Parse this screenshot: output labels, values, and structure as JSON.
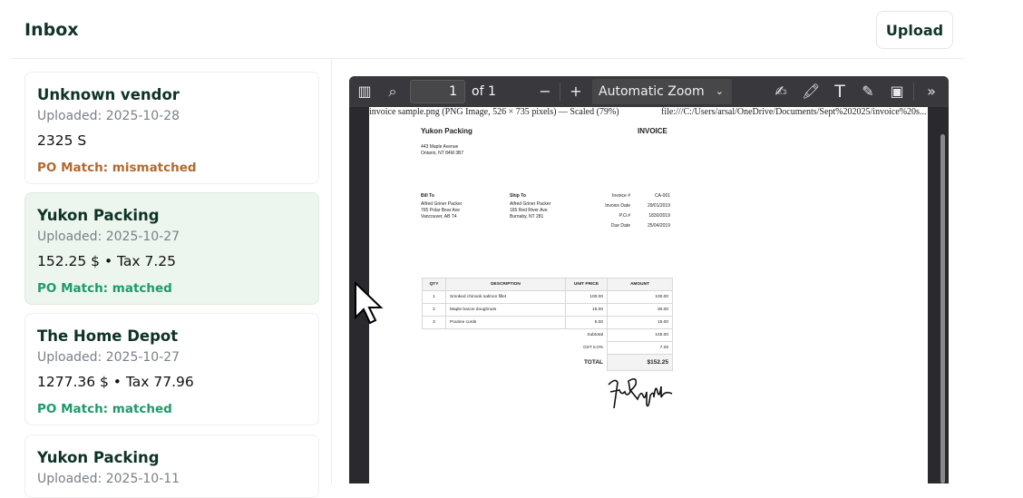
{
  "header": {
    "title": "Inbox",
    "upload_label": "Upload"
  },
  "invoices": [
    {
      "vendor": "Unknown vendor",
      "uploaded": "Uploaded: 2025-10-28",
      "amount": "2325 S",
      "po_match": "PO Match: mismatched"
    },
    {
      "vendor": "Yukon Packing",
      "uploaded": "Uploaded: 2025-10-27",
      "amount": "152.25 $ • Tax 7.25",
      "po_match": "PO Match: matched"
    },
    {
      "vendor": "The Home Depot",
      "uploaded": "Uploaded: 2025-10-27",
      "amount": "1277.36 $ • Tax 77.96",
      "po_match": "PO Match: matched"
    },
    {
      "vendor": "Yukon Packing",
      "uploaded": "Uploaded: 2025-10-11"
    }
  ],
  "viewer": {
    "page_number": "1",
    "page_count": "of 1",
    "zoom": "Automatic Zoom",
    "file_title": "invoice sample.png (PNG Image, 526 × 735 pixels) — Scaled (79%)",
    "file_url": "file:///C:/Users/arsal/OneDrive/Documents/Sept%202025/invoice%20s..."
  },
  "document": {
    "company": "Yukon Packing",
    "doc_title": "INVOICE",
    "address": [
      "443 Maple Avenue",
      "Ontario, NT 84M 3B7"
    ],
    "bill_to": {
      "label": "Bill To",
      "lines": [
        "Alfred Griner Packer",
        "765 Polar Bear Ave",
        "Vancouver, AB T4"
      ]
    },
    "ship_to": {
      "label": "Ship To",
      "lines": [
        "Alfred Griner Packer",
        "165 Red River Ave",
        "Burnaby, NT 281"
      ]
    },
    "meta": [
      [
        "Invoice #",
        "CA-001"
      ],
      [
        "Invoice Date",
        "29/01/2019"
      ],
      [
        "P.O.#",
        "1830/2019"
      ],
      [
        "Due Date",
        "25/04/2019"
      ]
    ],
    "columns": [
      "QTY",
      "DESCRIPTION",
      "UNIT PRICE",
      "AMOUNT"
    ],
    "rows": [
      [
        "1",
        "Smoked chinook salmon fillet",
        "100.00",
        "100.00"
      ],
      [
        "2",
        "Maple bacon doughnuts",
        "15.00",
        "30.00"
      ],
      [
        "3",
        "Poutine curds",
        "5.00",
        "15.00"
      ]
    ],
    "subtotal_label": "Subtotal",
    "subtotal": "145.00",
    "tax_label": "GST 5.0%",
    "tax": "7.25",
    "total_label": "TOTAL",
    "total": "$152.25"
  }
}
